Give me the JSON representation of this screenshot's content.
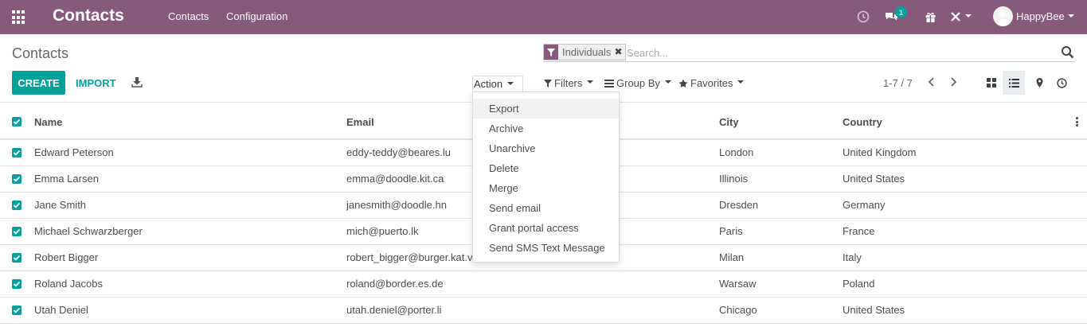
{
  "navbar": {
    "app_title": "Contacts",
    "menu": [
      "Contacts",
      "Configuration"
    ],
    "messages_badge": "1",
    "user_name": "HappyBee",
    "color": "#875a7b"
  },
  "control_panel": {
    "breadcrumb": "Contacts",
    "search": {
      "facet_label": "Individuals",
      "facet_remove": "✖",
      "placeholder": "Search..."
    },
    "create_label": "CREATE",
    "import_label": "IMPORT",
    "action_label": "Action",
    "filters_label": "Filters",
    "group_by_label": "Group By",
    "favorites_label": "Favorites",
    "pager": "1-7 / 7",
    "views": [
      "kanban-icon",
      "list-icon",
      "map-icon",
      "activity-icon"
    ],
    "accent_color": "#00a09d"
  },
  "action_menu": {
    "items": [
      "Export",
      "Archive",
      "Unarchive",
      "Delete",
      "Merge",
      "Send email",
      "Grant portal access",
      "Send SMS Text Message"
    ],
    "highlighted": "Export"
  },
  "table": {
    "columns": [
      "Name",
      "Email",
      "City",
      "Country"
    ],
    "rows": [
      {
        "name": "Edward Peterson",
        "email": "eddy-teddy@beares.lu",
        "city": "London",
        "country": "United Kingdom"
      },
      {
        "name": "Emma Larsen",
        "email": "emma@doodle.kit.ca",
        "city": "Illinois",
        "country": "United States"
      },
      {
        "name": "Jane Smith",
        "email": "janesmith@doodle.hn",
        "city": "Dresden",
        "country": "Germany"
      },
      {
        "name": "Michael Schwarzberger",
        "email": "mich@puerto.lk",
        "city": "Paris",
        "country": "France"
      },
      {
        "name": "Robert Bigger",
        "email": "robert_bigger@burger.kat.vc",
        "city": "Milan",
        "country": "Italy"
      },
      {
        "name": "Roland Jacobs",
        "email": "roland@border.es.de",
        "city": "Warsaw",
        "country": "Poland"
      },
      {
        "name": "Utah Deniel",
        "email": "utah.deniel@porter.li",
        "city": "Chicago",
        "country": "United States"
      }
    ]
  }
}
